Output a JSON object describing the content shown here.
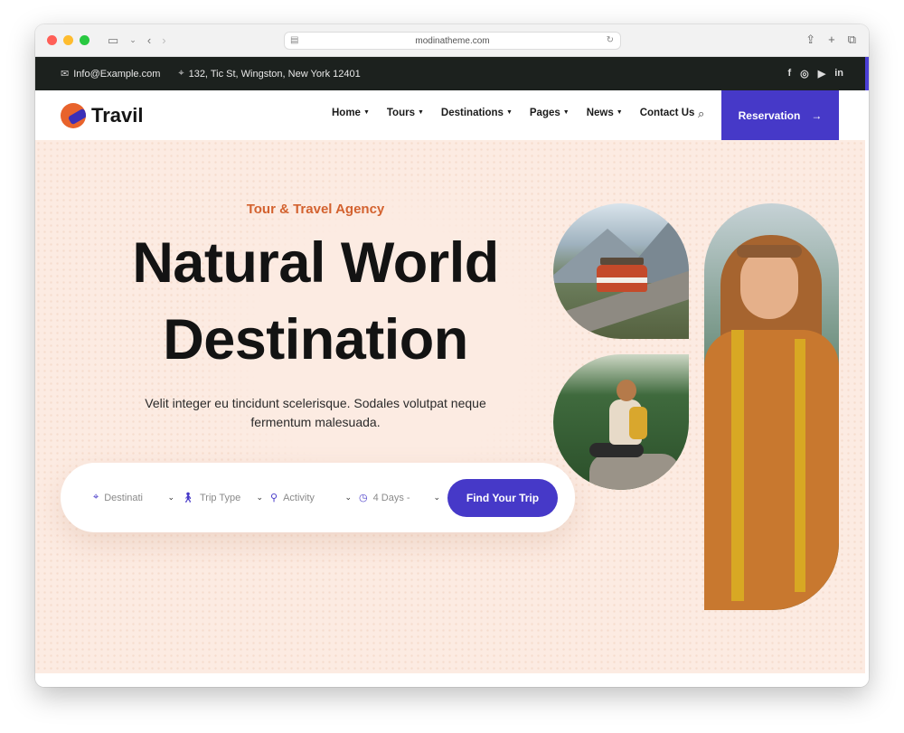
{
  "browser": {
    "url": "modinatheme.com"
  },
  "topbar": {
    "email": "Info@Example.com",
    "address": "132, Tic St, Wingston, New York 12401",
    "socials": [
      "f",
      "ig",
      "yt",
      "in"
    ]
  },
  "nav": {
    "logo": "Travil",
    "items": [
      {
        "label": "Home",
        "dropdown": true
      },
      {
        "label": "Tours",
        "dropdown": true
      },
      {
        "label": "Destinations",
        "dropdown": true
      },
      {
        "label": "Pages",
        "dropdown": true
      },
      {
        "label": "News",
        "dropdown": true
      },
      {
        "label": "Contact Us",
        "dropdown": false
      }
    ],
    "cta": "Reservation"
  },
  "hero": {
    "eyebrow": "Tour & Travel Agency",
    "title_line1": "Natural World",
    "title_line2": "Destination",
    "description": "Velit integer eu tincidunt scelerisque. Sodales volutpat neque fermentum malesuada."
  },
  "search": {
    "fields": [
      {
        "label": "Destinati",
        "icon": "map-pin-icon"
      },
      {
        "label": "Trip Type",
        "icon": "hiker-icon"
      },
      {
        "label": "Activity",
        "icon": "bicycle-icon"
      },
      {
        "label": "4 Days -",
        "icon": "clock-icon"
      }
    ],
    "button": "Find Your Trip"
  },
  "colors": {
    "primary": "#4639c8",
    "accent": "#d3622f",
    "hero_bg": "#fcebe2",
    "topbar_bg": "#1c211e"
  }
}
